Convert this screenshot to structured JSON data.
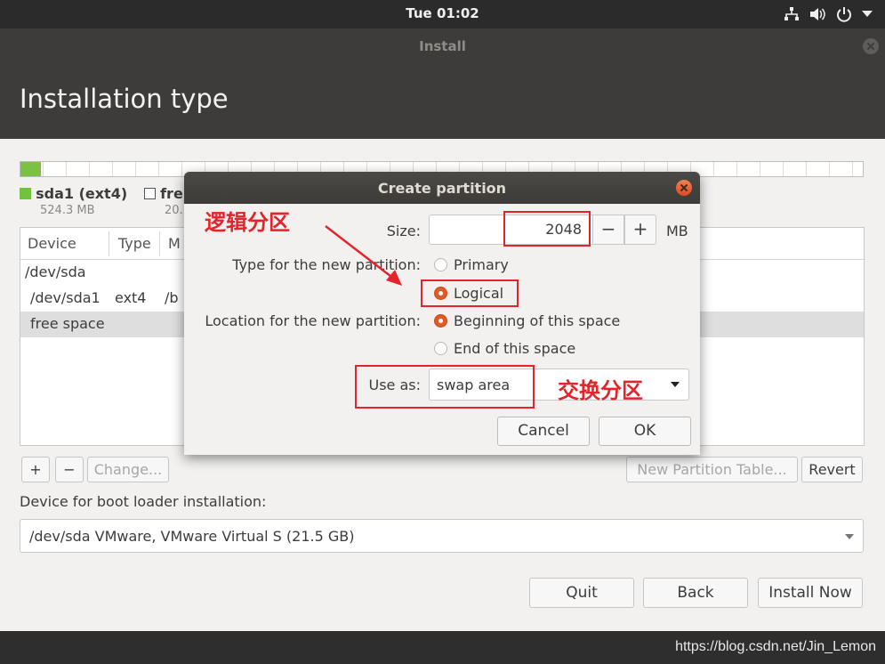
{
  "topbar": {
    "clock": "Tue 01:02",
    "icons": [
      "network-icon",
      "volume-icon",
      "power-icon",
      "chevron-down-icon"
    ]
  },
  "window": {
    "title": "Install",
    "heading": "Installation type"
  },
  "partitions_legend": [
    {
      "label": "sda1 (ext4)",
      "size": "524.3 MB",
      "color": "#73c23d"
    },
    {
      "label": "fre",
      "size": "20."
    }
  ],
  "table": {
    "columns": [
      "Device",
      "Type",
      "M"
    ],
    "rows": [
      {
        "device": "/dev/sda",
        "type": "",
        "mount": ""
      },
      {
        "device": "/dev/sda1",
        "type": "ext4",
        "mount": "/b"
      },
      {
        "device": "free space",
        "type": "",
        "mount": "",
        "selected": true
      }
    ]
  },
  "table_buttons": {
    "add": "+",
    "remove": "−",
    "change": "Change...",
    "new_table": "New Partition Table...",
    "revert": "Revert"
  },
  "boot": {
    "label": "Device for boot loader installation:",
    "value": "/dev/sda   VMware, VMware Virtual S (21.5 GB)"
  },
  "bottom_buttons": {
    "quit": "Quit",
    "back": "Back",
    "install": "Install Now"
  },
  "dialog": {
    "title": "Create partition",
    "size_label": "Size:",
    "size_value": "2048",
    "minus": "−",
    "plus": "+",
    "unit": "MB",
    "type_label": "Type for the new partition:",
    "type_options": [
      "Primary",
      "Logical"
    ],
    "type_selected": "Logical",
    "location_label": "Location for the new partition:",
    "location_options": [
      "Beginning of this space",
      "End of this space"
    ],
    "location_selected": "Beginning of this space",
    "useas_label": "Use as:",
    "useas_value": "swap area",
    "cancel": "Cancel",
    "ok": "OK"
  },
  "annotations": {
    "logical": "逻辑分区",
    "swap": "交换分区",
    "color": "#e3242b"
  },
  "watermark": "https://blog.csdn.net/Jin_Lemon",
  "colors": {
    "accent": "#e05a27",
    "partition_used": "#7bc143",
    "panel": "#2b2b2b"
  }
}
